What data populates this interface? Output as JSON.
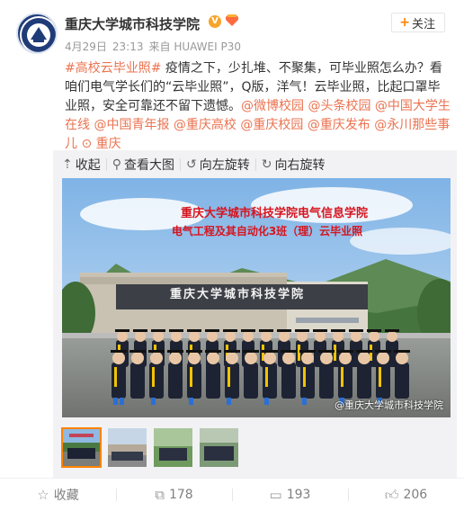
{
  "header": {
    "poster_name": "重庆大学城市科技学院",
    "verified_symbol": "V",
    "badge_icon": "heart-badge-icon",
    "date": "4月29日",
    "time": "23:13",
    "source": "来自 HUAWEI P30",
    "follow_label": "关注"
  },
  "post": {
    "topic": "#高校云毕业照#",
    "text1": " 疫情之下，少扎堆、不聚集，可毕业照怎么办？看咱们电气学长们的“云毕业照”，Q版，洋气！云毕业照，比起口罩毕业照，安全可靠还不留下遗憾。",
    "mentions": [
      "@微博校园",
      "@头条校园",
      "@中国大学生在线",
      "@中国青年报",
      "@重庆高校",
      "@重庆校园",
      "@重庆发布",
      "@永川那些事儿"
    ],
    "location": "重庆"
  },
  "media": {
    "tools": [
      "收起",
      "查看大图",
      "向左旋转",
      "向右旋转"
    ],
    "photo": {
      "title_line1": "重庆大学城市科技学院电气信息学院",
      "title_line2": "电气工程及其自动化3班（理）云毕业照",
      "building_sign": "重庆大学城市科技学院",
      "watermark": "@重庆大学城市科技学院"
    },
    "thumbnail_count": 4
  },
  "footer": {
    "favorite_label": "收藏",
    "repost_count": "178",
    "comment_count": "193",
    "like_count": "206"
  },
  "colors": {
    "accent": "#eb7350",
    "follow_plus": "#ff8200",
    "photo_title": "#d7141e"
  }
}
